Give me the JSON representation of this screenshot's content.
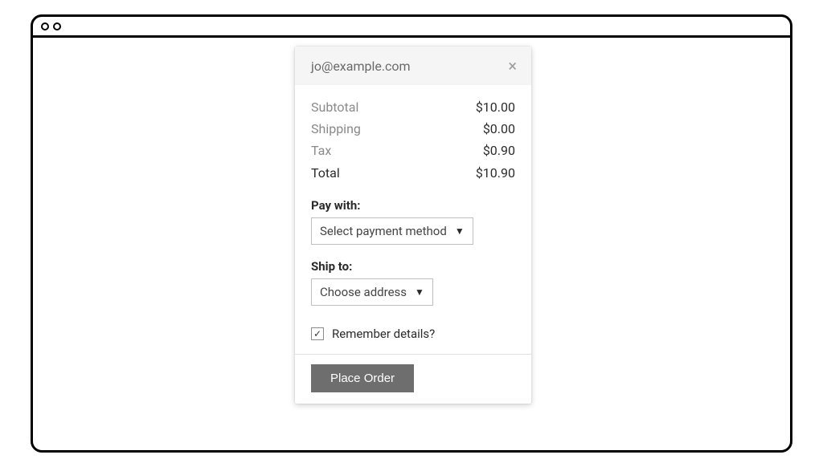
{
  "header": {
    "email": "jo@example.com"
  },
  "summary": {
    "subtotal_label": "Subtotal",
    "subtotal_value": "$10.00",
    "shipping_label": "Shipping",
    "shipping_value": "$0.00",
    "tax_label": "Tax",
    "tax_value": "$0.90",
    "total_label": "Total",
    "total_value": "$10.90"
  },
  "payment": {
    "section_label": "Pay with:",
    "placeholder": "Select payment method"
  },
  "shipping": {
    "section_label": "Ship to:",
    "placeholder": "Choose address"
  },
  "remember": {
    "label": "Remember details?",
    "checked_glyph": "✓"
  },
  "footer": {
    "place_order_label": "Place Order"
  }
}
